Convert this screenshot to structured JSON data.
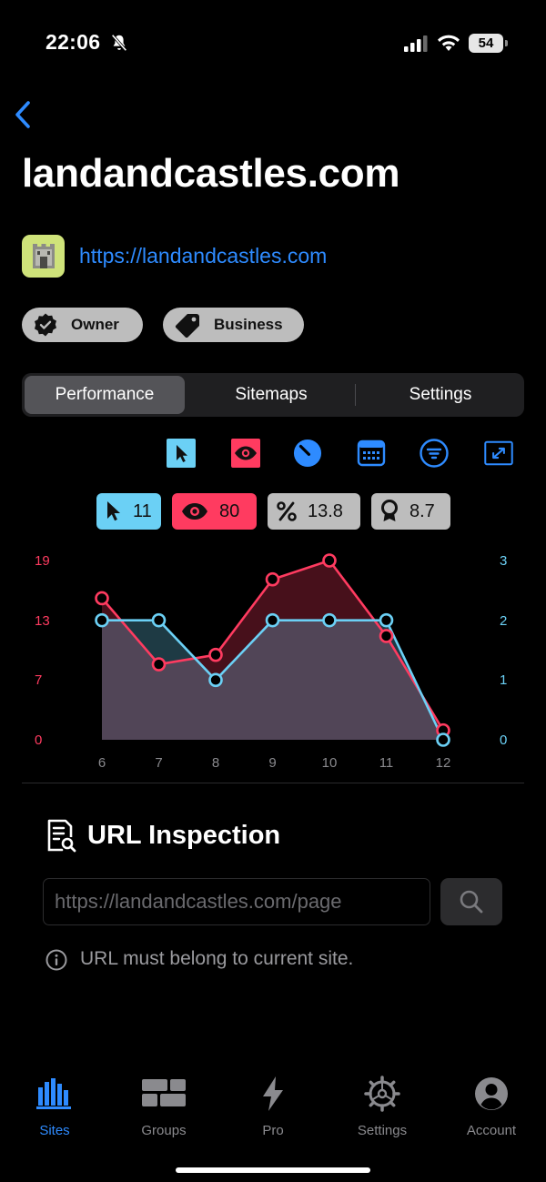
{
  "status_bar": {
    "time": "22:06",
    "battery": "54"
  },
  "site": {
    "title": "landandcastles.com",
    "url": "https://landandcastles.com",
    "chips": [
      "Owner",
      "Business"
    ]
  },
  "tabs": [
    "Performance",
    "Sitemaps",
    "Settings"
  ],
  "metrics": {
    "clicks": "11",
    "impressions": "80",
    "ctr": "13.8",
    "position": "8.7"
  },
  "colors": {
    "accent": "#2e8bff",
    "clicks": "#6bd0f5",
    "impressions": "#ff3b60"
  },
  "chart_data": {
    "type": "line",
    "x": [
      6,
      7,
      8,
      9,
      10,
      11,
      12
    ],
    "series": [
      {
        "values": [
          15,
          8,
          9,
          17,
          19,
          11,
          1
        ],
        "axis": "left",
        "color": "#ff3b60"
      },
      {
        "values": [
          2,
          2,
          1,
          2,
          2,
          2,
          0
        ],
        "axis": "right",
        "color": "#6bd0f5"
      }
    ],
    "y_left_ticks": [
      "19",
      "13",
      "7",
      "0"
    ],
    "y_right_ticks": [
      "3",
      "2",
      "1",
      "0"
    ],
    "ylim_left": [
      0,
      19
    ],
    "ylim_right": [
      0,
      3
    ],
    "x_tick_labels": [
      "6",
      "7",
      "8",
      "9",
      "10",
      "11",
      "12"
    ]
  },
  "inspection": {
    "title": "URL Inspection",
    "placeholder": "https://landandcastles.com/page",
    "note": "URL must belong to current site."
  },
  "tab_bar": [
    "Sites",
    "Groups",
    "Pro",
    "Settings",
    "Account"
  ]
}
